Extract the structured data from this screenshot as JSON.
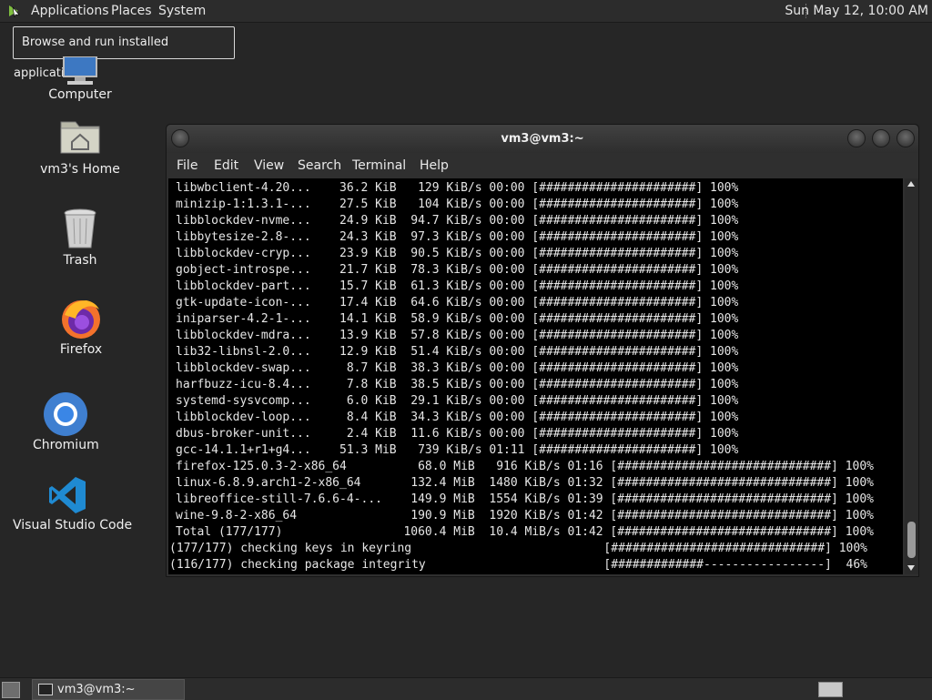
{
  "top_panel": {
    "applications": "Applications",
    "places": "Places",
    "system": "System",
    "clock": "Sun May 12, 10:00 AM"
  },
  "tooltip": "Browse and run installed applications",
  "desktop_icons": [
    {
      "label": "Computer",
      "icon": "computer-icon"
    },
    {
      "label": "vm3's Home",
      "icon": "home-folder-icon"
    },
    {
      "label": "Trash",
      "icon": "trash-icon"
    },
    {
      "label": "Firefox",
      "icon": "firefox-icon"
    },
    {
      "label": "Chromium",
      "icon": "chromium-icon"
    },
    {
      "label": "Visual Studio Code",
      "icon": "vscode-icon"
    }
  ],
  "terminal": {
    "title": "vm3@vm3:~",
    "menu": [
      "File",
      "Edit",
      "View",
      "Search",
      "Terminal",
      "Help"
    ],
    "lines": [
      "libwbclient-4.20...    36.2 KiB   129 KiB/s 00:00 [######################] 100%",
      "minizip-1:1.3.1-...    27.5 KiB   104 KiB/s 00:00 [######################] 100%",
      "libblockdev-nvme...    24.9 KiB  94.7 KiB/s 00:00 [######################] 100%",
      "libbytesize-2.8-...    24.3 KiB  97.3 KiB/s 00:00 [######################] 100%",
      "libblockdev-cryp...    23.9 KiB  90.5 KiB/s 00:00 [######################] 100%",
      "gobject-introspe...    21.7 KiB  78.3 KiB/s 00:00 [######################] 100%",
      "libblockdev-part...    15.7 KiB  61.3 KiB/s 00:00 [######################] 100%",
      "gtk-update-icon-...    17.4 KiB  64.6 KiB/s 00:00 [######################] 100%",
      "iniparser-4.2-1-...    14.1 KiB  58.9 KiB/s 00:00 [######################] 100%",
      "libblockdev-mdra...    13.9 KiB  57.8 KiB/s 00:00 [######################] 100%",
      "lib32-libnsl-2.0...    12.9 KiB  51.4 KiB/s 00:00 [######################] 100%",
      "libblockdev-swap...     8.7 KiB  38.3 KiB/s 00:00 [######################] 100%",
      "harfbuzz-icu-8.4...     7.8 KiB  38.5 KiB/s 00:00 [######################] 100%",
      "systemd-sysvcomp...     6.0 KiB  29.1 KiB/s 00:00 [######################] 100%",
      "libblockdev-loop...     8.4 KiB  34.3 KiB/s 00:00 [######################] 100%",
      "dbus-broker-unit...     2.4 KiB  11.6 KiB/s 00:00 [######################] 100%",
      "gcc-14.1.1+r1+g4...    51.3 MiB   739 KiB/s 01:11 [######################] 100%",
      "firefox-125.0.3-2-x86_64          68.0 MiB   916 KiB/s 01:16 [##############################] 100%",
      "linux-6.8.9.arch1-2-x86_64       132.4 MiB  1480 KiB/s 01:32 [##############################] 100%",
      "libreoffice-still-7.6.6-4-...    149.9 MiB  1554 KiB/s 01:39 [##############################] 100%",
      "wine-9.8-2-x86_64                190.9 MiB  1920 KiB/s 01:42 [##############################] 100%",
      "Total (177/177)                 1060.4 MiB  10.4 MiB/s 01:42 [##############################] 100%",
      "(177/177) checking keys in keyring                           [##############################] 100%",
      "(116/177) checking package integrity                         [#############-----------------]  46%"
    ]
  },
  "taskbar": {
    "task_label": "vm3@vm3:~"
  }
}
